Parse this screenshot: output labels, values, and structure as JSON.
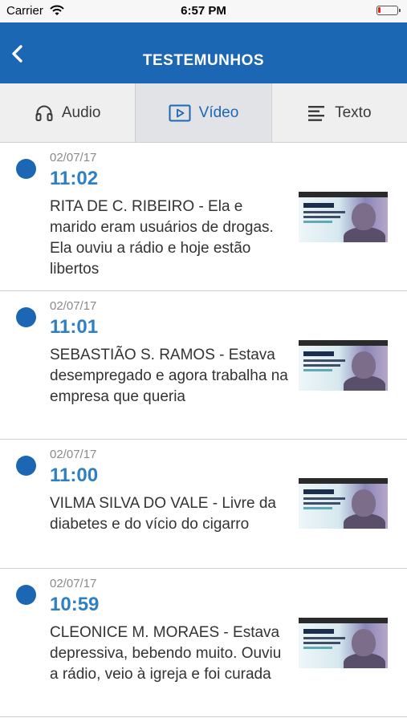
{
  "status_bar": {
    "carrier": "Carrier",
    "time": "6:57 PM"
  },
  "header": {
    "title": "TESTEMUNHOS",
    "back_icon": "chevron-left-icon"
  },
  "tabs": [
    {
      "label": "Audio",
      "icon": "headphones-icon",
      "active": false
    },
    {
      "label": "Vídeo",
      "icon": "play-icon",
      "active": true
    },
    {
      "label": "Texto",
      "icon": "text-lines-icon",
      "active": false
    }
  ],
  "items": [
    {
      "date": "02/07/17",
      "time": "11:02",
      "description": "RITA DE C. RIBEIRO - Ela e marido eram usuários de drogas. Ela ouviu a rádio e hoje estão libertos"
    },
    {
      "date": "02/07/17",
      "time": "11:01",
      "description": "SEBASTIÃO S. RAMOS - Estava desempregado e agora trabalha na empresa que queria"
    },
    {
      "date": "02/07/17",
      "time": "11:00",
      "description": "VILMA SILVA DO VALE - Livre da diabetes e do vício do cigarro"
    },
    {
      "date": "02/07/17",
      "time": "10:59",
      "description": "CLEONICE M. MORAES - Estava depressiva, bebendo muito. Ouviu a rádio, veio à igreja e foi curada"
    }
  ],
  "colors": {
    "primary": "#1c67b3",
    "accent_time": "#2f80c3",
    "battery_low": "#e2231a"
  }
}
